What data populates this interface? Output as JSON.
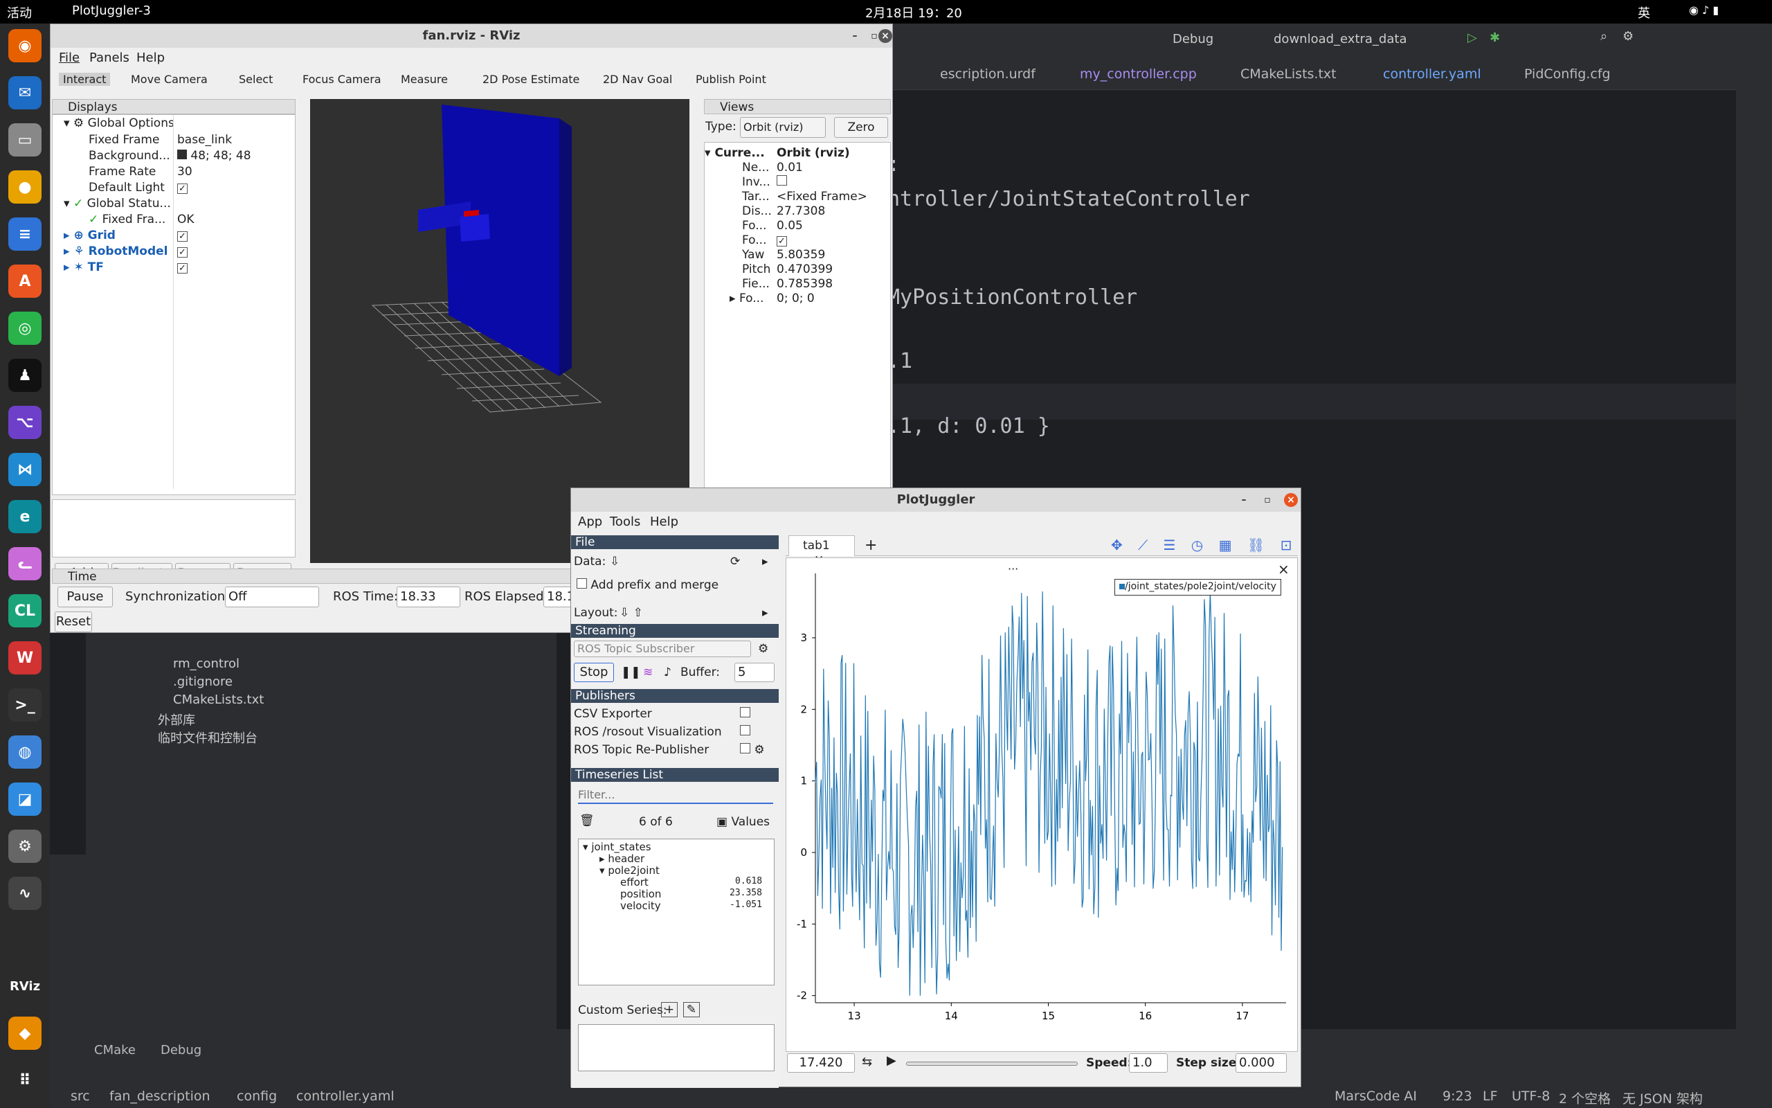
{
  "topbar": {
    "activities": "活动",
    "app": "PlotJuggler-3",
    "datetime": "2月18日 19：20",
    "lang": "英"
  },
  "ide": {
    "run_config": "Debug",
    "target": "download_extra_data",
    "tabs": [
      "escription.urdf",
      "my_controller.cpp",
      "CMakeLists.txt",
      "controller.yaml",
      "PidConfig.cfg"
    ],
    "code": [
      ":",
      "ntroller/JointStateController",
      "MyPositionController",
      ".1",
      ".1, d: 0.01 }"
    ],
    "tree": [
      "rm_control",
      ".gitignore",
      "CMakeLists.txt",
      "外部库",
      "临时文件和控制台"
    ],
    "bottom_tabs": [
      "CMake",
      "Debug"
    ],
    "breadcrumb": [
      "src",
      "fan_description",
      "config",
      "controller.yaml"
    ],
    "status": [
      "MarsCode AI",
      "9:23",
      "LF",
      "UTF-8",
      "2 个空格",
      "无 JSON 架构"
    ]
  },
  "rviz": {
    "title": "fan.rviz - RViz",
    "menu": [
      "File",
      "Panels",
      "Help"
    ],
    "tools": [
      "Interact",
      "Move Camera",
      "Select",
      "Focus Camera",
      "Measure",
      "2D Pose Estimate",
      "2D Nav Goal",
      "Publish Point"
    ],
    "displays_title": "Displays",
    "displays": [
      {
        "label": "Global Options",
        "value": ""
      },
      {
        "label": "Fixed Frame",
        "value": "base_link"
      },
      {
        "label": "Background...",
        "value": "48; 48; 48"
      },
      {
        "label": "Frame Rate",
        "value": "30"
      },
      {
        "label": "Default Light",
        "value": "✓"
      },
      {
        "label": "Global Statu...",
        "value": ""
      },
      {
        "label": "Fixed Fra...",
        "value": "OK"
      },
      {
        "label": "Grid",
        "value": "✓"
      },
      {
        "label": "RobotModel",
        "value": "✓"
      },
      {
        "label": "TF",
        "value": "✓"
      }
    ],
    "display_buttons": [
      "Add",
      "Duplicate",
      "Remove",
      "Rename"
    ],
    "views_title": "Views",
    "view_type_label": "Type:",
    "view_type": "Orbit (rviz)",
    "zero": "Zero",
    "views": [
      {
        "label": "Curre...",
        "value": "Orbit (rviz)"
      },
      {
        "label": "Ne...",
        "value": "0.01"
      },
      {
        "label": "Inv...",
        "value": ""
      },
      {
        "label": "Tar...",
        "value": "<Fixed Frame>"
      },
      {
        "label": "Dis...",
        "value": "27.7308"
      },
      {
        "label": "Fo...",
        "value": "0.05"
      },
      {
        "label": "Fo...",
        "value": "✓"
      },
      {
        "label": "Yaw",
        "value": "5.80359"
      },
      {
        "label": "Pitch",
        "value": "0.470399"
      },
      {
        "label": "Fie...",
        "value": "0.785398"
      },
      {
        "label": "Fo...",
        "value": "0; 0; 0"
      }
    ],
    "time_title": "Time",
    "pause": "Pause",
    "sync_label": "Synchronization:",
    "sync_value": "Off",
    "ros_time_label": "ROS Time:",
    "ros_time": "18.33",
    "ros_elapsed_label": "ROS Elapsed:",
    "ros_elapsed": "18.1",
    "reset": "Reset"
  },
  "pj": {
    "title": "PlotJuggler",
    "menu": [
      "App",
      "Tools",
      "Help"
    ],
    "file": "File",
    "data_label": "Data:",
    "prefix": "Add prefix and merge",
    "layout_label": "Layout:",
    "streaming": "Streaming",
    "subscriber": "ROS Topic Subscriber",
    "stop": "Stop",
    "buffer_label": "Buffer:",
    "buffer": "5",
    "publishers": "Publishers",
    "pub_items": [
      "CSV Exporter",
      "ROS /rosout Visualization",
      "ROS Topic Re-Publisher"
    ],
    "ts_title": "Timeseries List",
    "filter_placeholder": "Filter...",
    "count": "6 of 6",
    "values": "Values",
    "tree": [
      {
        "label": "joint_states",
        "value": ""
      },
      {
        "label": "header",
        "value": ""
      },
      {
        "label": "pole2joint",
        "value": ""
      },
      {
        "label": "effort",
        "value": "0.618"
      },
      {
        "label": "position",
        "value": "23.358"
      },
      {
        "label": "velocity",
        "value": "-1.051"
      }
    ],
    "custom": "Custom Series:",
    "tab": "tab1",
    "time_value": "17.420",
    "speed_label": "Speed:",
    "speed": "1.0",
    "step_label": "Step size:",
    "step": "0.000"
  },
  "chart_data": {
    "type": "line",
    "series": [
      {
        "name": "/joint_states/pole2joint/velocity"
      }
    ],
    "xlim": [
      12.6,
      17.45
    ],
    "ylim": [
      -2.1,
      3.9
    ],
    "xticks": [
      13,
      14,
      15,
      16,
      17
    ],
    "yticks": [
      -2,
      -1,
      0,
      1,
      2,
      3
    ],
    "color": "#1f77b4"
  }
}
